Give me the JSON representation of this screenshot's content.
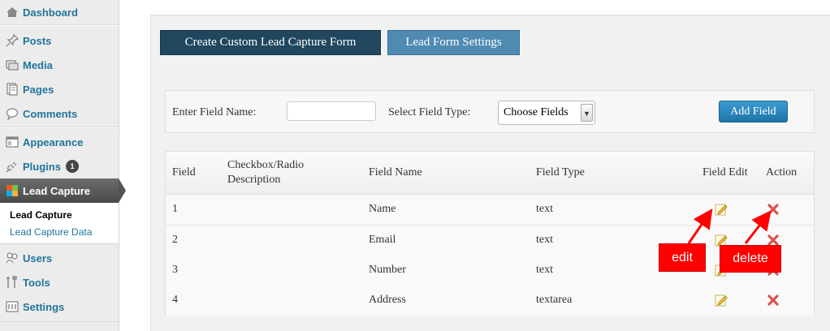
{
  "sidebar": {
    "items": [
      {
        "label": "Dashboard",
        "icon": "dashboard-icon"
      },
      {
        "label": "Posts",
        "icon": "pushpin-icon"
      },
      {
        "label": "Media",
        "icon": "media-icon"
      },
      {
        "label": "Pages",
        "icon": "pages-icon"
      },
      {
        "label": "Comments",
        "icon": "comment-bubble-icon"
      },
      {
        "label": "Appearance",
        "icon": "appearance-icon"
      },
      {
        "label": "Plugins",
        "icon": "plug-icon",
        "badge": "1"
      },
      {
        "label": "Lead Capture",
        "icon": "lead-capture-icon"
      },
      {
        "label": "Users",
        "icon": "users-icon"
      },
      {
        "label": "Tools",
        "icon": "tools-icon"
      },
      {
        "label": "Settings",
        "icon": "settings-icon"
      }
    ],
    "submenu": [
      {
        "label": "Lead Capture"
      },
      {
        "label": "Lead Capture Data"
      }
    ]
  },
  "tabs": {
    "create": "Create Custom Lead Capture Form",
    "settings": "Lead Form Settings"
  },
  "form": {
    "field_name_label": "Enter Field Name:",
    "field_name_value": "",
    "field_type_label": "Select Field Type:",
    "field_type_selected": "Choose Fields",
    "add_button": "Add Field"
  },
  "table": {
    "headers": {
      "field": "Field",
      "checkbox_desc_line1": "Checkbox/Radio",
      "checkbox_desc_line2": "Description",
      "field_name": "Field Name",
      "field_type": "Field Type",
      "field_edit": "Field Edit",
      "action": "Action"
    },
    "rows": [
      {
        "field": "1",
        "name": "Name",
        "type": "text"
      },
      {
        "field": "2",
        "name": "Email",
        "type": "text"
      },
      {
        "field": "3",
        "name": "Number",
        "type": "text"
      },
      {
        "field": "4",
        "name": "Address",
        "type": "textarea"
      }
    ]
  },
  "annotations": {
    "edit": "edit",
    "delete": "delete"
  },
  "colors": {
    "sidebar_link": "#21759b",
    "tab_create_bg": "#21475f",
    "tab_settings_bg": "#4f8ab1",
    "add_button_bg": "#2a86bd",
    "annotation_red": "#ff0000",
    "delete_icon": "#d9534f"
  }
}
